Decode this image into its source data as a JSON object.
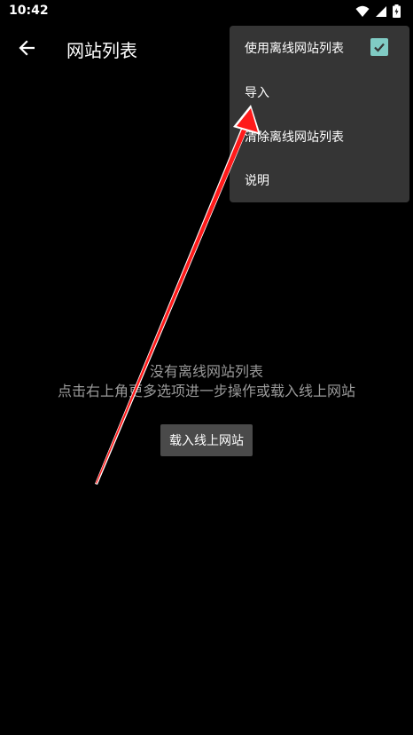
{
  "status_bar": {
    "time": "10:42"
  },
  "app_bar": {
    "title": "网站列表"
  },
  "empty_state": {
    "line1": "没有离线网站列表",
    "line2": "点击右上角更多选项进一步操作或载入线上网站",
    "load_button": "载入线上网站"
  },
  "menu": {
    "items": [
      {
        "label": "使用离线网站列表",
        "checked": true
      },
      {
        "label": "导入"
      },
      {
        "label": "清除离线网站列表"
      },
      {
        "label": "说明"
      }
    ]
  },
  "colors": {
    "background": "#000000",
    "menu_bg": "#353535",
    "checkbox": "#80cbc4",
    "button_bg": "#4a4a4a",
    "annotation_arrow": "#ff1a1a"
  }
}
